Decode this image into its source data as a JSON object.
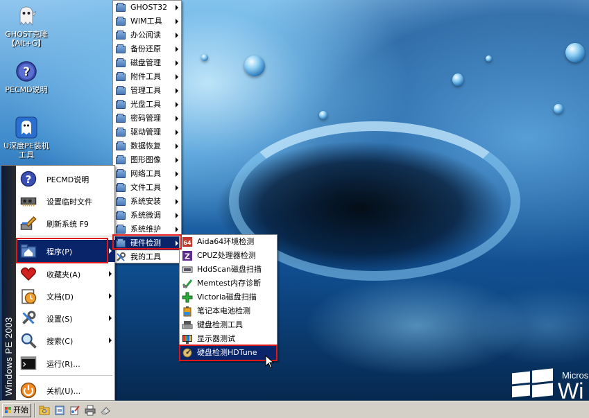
{
  "desktop": {
    "icons": [
      {
        "label_line1": "GHOST克隆",
        "label_line2": "【Alt+G】",
        "icon": "ghost-icon"
      },
      {
        "label_line1": "PECMD说明",
        "label_line2": "",
        "icon": "help-icon"
      },
      {
        "label_line1": "U深度PE装机",
        "label_line2": "工具",
        "icon": "installer-ghost-icon"
      }
    ],
    "watermark": {
      "line1": "Micros",
      "line2": "Wi"
    }
  },
  "start_menu": {
    "band_text": "Windows PE 2003",
    "items": [
      {
        "label": "PECMD说明",
        "icon": "help-icon",
        "submenu": false
      },
      {
        "label": "设置临时文件",
        "icon": "memory-chip-icon",
        "submenu": false
      },
      {
        "label": "刷新系统 F9",
        "icon": "paint-brush-icon",
        "submenu": false
      },
      {
        "label": "程序(P)",
        "icon": "programs-folder-icon",
        "submenu": true
      },
      {
        "label": "收藏夹(A)",
        "icon": "heart-icon",
        "submenu": true
      },
      {
        "label": "文档(D)",
        "icon": "documents-icon",
        "submenu": true
      },
      {
        "label": "设置(S)",
        "icon": "tools-icon",
        "submenu": true
      },
      {
        "label": "搜索(C)",
        "icon": "magnifier-icon",
        "submenu": true
      },
      {
        "label": "运行(R)...",
        "icon": "terminal-icon",
        "submenu": false
      },
      {
        "label": "关机(U)...",
        "icon": "shutdown-icon",
        "submenu": false
      }
    ]
  },
  "programs_menu": {
    "items": [
      {
        "label": "GHOST32"
      },
      {
        "label": "WIM工具"
      },
      {
        "label": "办公阅读"
      },
      {
        "label": "备份还原"
      },
      {
        "label": "磁盘管理"
      },
      {
        "label": "附件工具"
      },
      {
        "label": "管理工具"
      },
      {
        "label": "光盘工具"
      },
      {
        "label": "密码管理"
      },
      {
        "label": "驱动管理"
      },
      {
        "label": "数据恢复"
      },
      {
        "label": "图形图像"
      },
      {
        "label": "网络工具"
      },
      {
        "label": "文件工具"
      },
      {
        "label": "系统安装"
      },
      {
        "label": "系统微调"
      },
      {
        "label": "系统维护"
      },
      {
        "label": "硬件检测"
      },
      {
        "label": "我的工具"
      }
    ]
  },
  "hardware_menu": {
    "items": [
      {
        "label": "Aida64环境检测",
        "icon": "aida64-icon"
      },
      {
        "label": "CPUZ处理器检测",
        "icon": "cpuz-icon"
      },
      {
        "label": "HddScan磁盘扫描",
        "icon": "hddscan-icon"
      },
      {
        "label": "Memtest内存诊断",
        "icon": "memtest-icon"
      },
      {
        "label": "Victoria磁盘扫描",
        "icon": "victoria-icon"
      },
      {
        "label": "笔记本电池检测",
        "icon": "battery-icon"
      },
      {
        "label": "键盘检测工具",
        "icon": "keyboard-icon"
      },
      {
        "label": "显示器测试",
        "icon": "monitor-test-icon"
      },
      {
        "label": "硬盘检测HDTune",
        "icon": "hdtune-icon"
      }
    ]
  },
  "taskbar": {
    "start_label": "开始",
    "quick_launch": [
      "folder-icon",
      "notepad-icon",
      "paint-icon",
      "printer-icon",
      "eraser-icon"
    ]
  },
  "colors": {
    "highlight": "#0a246a",
    "callout_red": "#e01818",
    "taskbar": "#d4d0c8"
  }
}
